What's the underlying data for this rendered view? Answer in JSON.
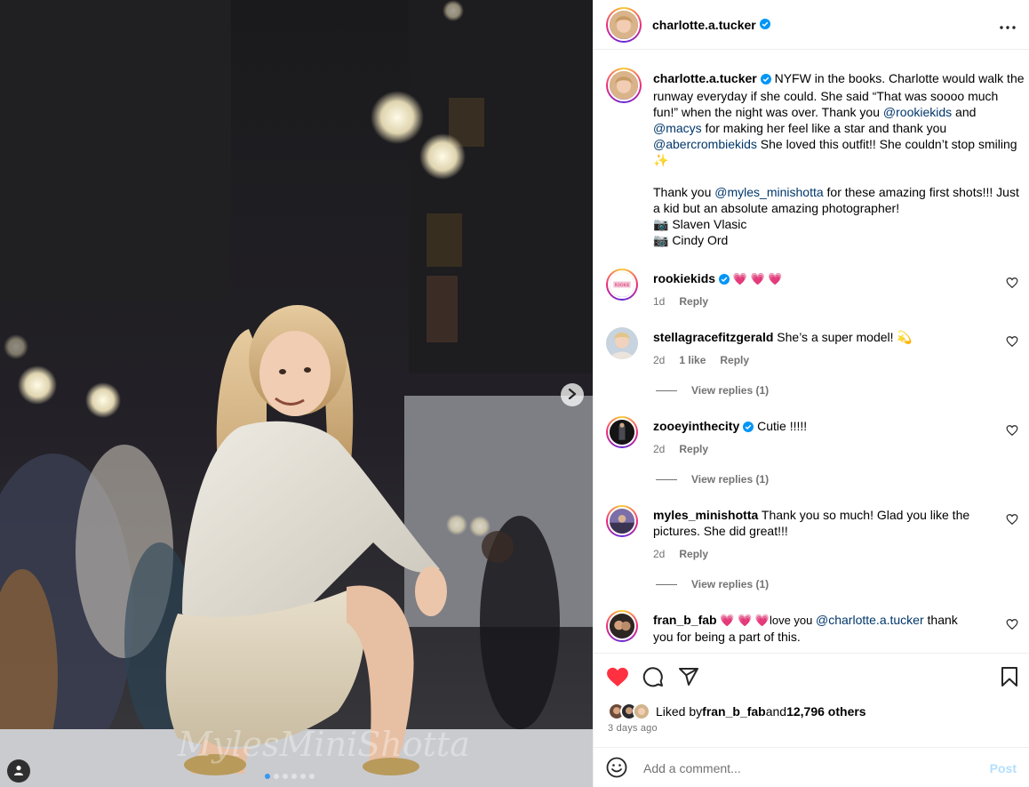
{
  "post": {
    "author": "charlotte.a.tucker",
    "verified": true,
    "more_icon": "more-horizontal-icon",
    "carousel": {
      "slide_count": 6,
      "active_index": 0
    }
  },
  "caption": {
    "username": "charlotte.a.tucker",
    "text_1": " NYFW in the books. Charlotte would walk the runway everyday if she could. She said “That was soooo much fun!” when the night was over. Thank you ",
    "mention_1": "@rookiekids",
    "text_2": " and ",
    "mention_2": "@macys",
    "text_3": " for making her feel like a star and thank you ",
    "mention_3": "@abercrombiekids",
    "text_4": " She loved this outfit!! She couldn’t stop smiling ✨\n\nThank you ",
    "mention_4": "@myles_minishotta",
    "text_5": " for these amazing first shots!!! Just a kid but an absolute amazing photographer!\n📷 Slaven Vlasic\n📷 Cindy Ord",
    "age": "3d"
  },
  "comments": [
    {
      "username": "rookiekids",
      "verified": true,
      "text": " 💗 💗 💗",
      "age": "1d",
      "likes": "",
      "reply": "Reply",
      "replies": ""
    },
    {
      "username": "stellagracefitzgerald",
      "verified": false,
      "text": " She’s a super model! 💫",
      "age": "2d",
      "likes": "1 like",
      "reply": "Reply",
      "replies": "View replies (1)"
    },
    {
      "username": "zooeyinthecity",
      "verified": true,
      "text": " Cutie !!!!!",
      "age": "2d",
      "likes": "",
      "reply": "Reply",
      "replies": "View replies (1)"
    },
    {
      "username": "myles_minishotta",
      "verified": false,
      "text": " Thank you so much! Glad you like the pictures. She did great!!!",
      "age": "2d",
      "likes": "",
      "reply": "Reply",
      "replies": "View replies (1)"
    },
    {
      "username": "fran_b_fab",
      "verified": false,
      "text_1": " 💗 💗 💗love you ",
      "mention": "@charlotte.a.tucker",
      "text_2": " thank you for being a part of this."
    }
  ],
  "actions": {
    "like_icon": "heart-filled-icon",
    "comment_icon": "comment-icon",
    "share_icon": "share-icon",
    "save_icon": "bookmark-icon",
    "like_color": "#ff3040"
  },
  "likes": {
    "prefix": "Liked by ",
    "user": "fran_b_fab",
    "middle": " and ",
    "count": "12,796 others"
  },
  "posted": "3 days ago",
  "add_comment": {
    "placeholder": "Add a comment...",
    "post_label": "Post",
    "emoji_icon": "emoji-icon"
  }
}
